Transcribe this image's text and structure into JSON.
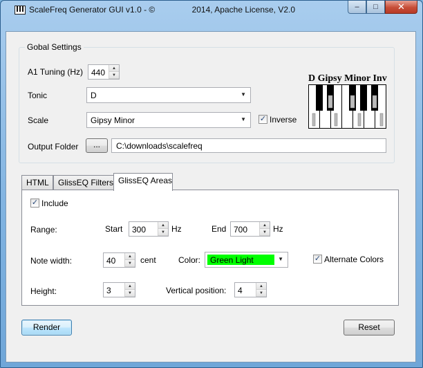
{
  "window": {
    "title": "ScaleFreq Generator GUI v1.0 - ©                2014, Apache License, V2.0",
    "minimize": "–",
    "maximize": "□",
    "close": "✕"
  },
  "global": {
    "group_label": "Gobal Settings",
    "a1_label": "A1 Tuning (Hz)",
    "a1_value": "440",
    "tonic_label": "Tonic",
    "tonic_value": "D",
    "scale_label": "Scale",
    "scale_value": "Gipsy Minor",
    "inverse_label": "Inverse",
    "inverse_checked": true,
    "output_label": "Output Folder",
    "browse_label": "...",
    "output_value": "C:\\downloads\\scalefreq",
    "piano_title": "D Gipsy Minor Inv"
  },
  "tabs": [
    {
      "label": "HTML"
    },
    {
      "label": "GlissEQ Filters"
    },
    {
      "label": "GlissEQ Areas"
    }
  ],
  "areas": {
    "include_label": "Include",
    "include_checked": true,
    "range_label": "Range:",
    "start_label": "Start",
    "start_value": "300",
    "start_unit": "Hz",
    "end_label": "End",
    "end_value": "700",
    "end_unit": "Hz",
    "note_width_label": "Note width:",
    "note_width_value": "40",
    "note_width_unit": "cent",
    "color_label": "Color:",
    "color_value": "Green Light",
    "color_swatch": "#00ff00",
    "alternate_label": "Alternate Colors",
    "alternate_checked": true,
    "height_label": "Height:",
    "height_value": "3",
    "vpos_label": "Vertical position:",
    "vpos_value": "4"
  },
  "footer": {
    "render_label": "Render",
    "reset_label": "Reset"
  },
  "icons": {
    "check": "✓",
    "caret": "▼",
    "up": "▲",
    "down": "▼"
  }
}
